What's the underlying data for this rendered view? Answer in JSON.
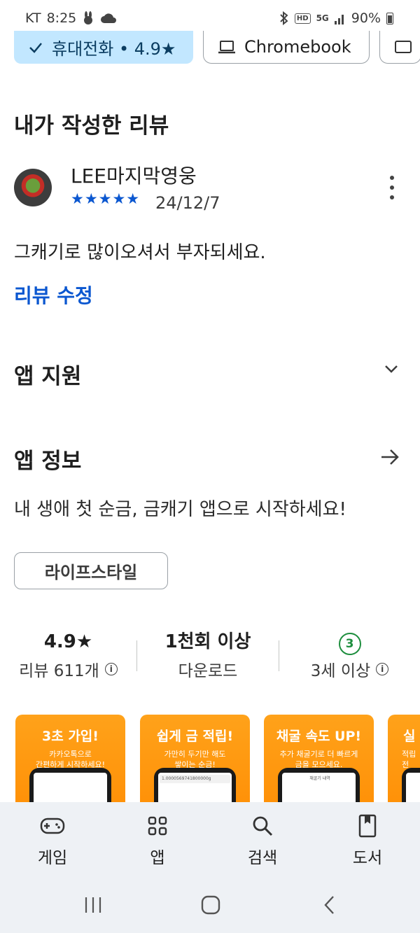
{
  "status_bar": {
    "carrier": "KT",
    "time": "8:25",
    "network": "5G",
    "battery": "90%",
    "icons": [
      "rabbit-icon",
      "cloud-icon",
      "bluetooth-icon",
      "hd-icon",
      "signal-icon",
      "battery-icon"
    ]
  },
  "device_chips": [
    {
      "label": "휴대전화 • 4.9★",
      "icon": "check-icon",
      "selected": true
    },
    {
      "label": "Chromebook",
      "icon": "laptop-icon",
      "selected": false
    },
    {
      "label": "",
      "icon": "tablet-icon",
      "selected": false
    }
  ],
  "my_review": {
    "section_title": "내가 작성한 리뷰",
    "reviewer_name": "LEE마지막영웅",
    "stars": "★★★★★",
    "rating": 5,
    "date": "24/12/7",
    "text": "그캐기로 많이오셔서 부자되세요.",
    "edit_label": "리뷰 수정"
  },
  "app_support": {
    "title": "앱 지원",
    "icon": "chevron-down-icon"
  },
  "app_info": {
    "title": "앱 정보",
    "icon": "arrow-right-icon",
    "description": "내 생애 첫 순금, 금캐기 앱으로 시작하세요!",
    "category": "라이프스타일"
  },
  "stats": {
    "rating_value": "4.9★",
    "rating_label": "리뷰 611개",
    "downloads_value": "1천회 이상",
    "downloads_label": "다운로드",
    "age_badge": "3",
    "age_label": "3세 이상"
  },
  "screenshots": [
    {
      "title": "3초 가입!",
      "subtitle": "카카오톡으로\n간편하게 시작하세요!",
      "screen_text": ""
    },
    {
      "title": "쉽게 금 적립!",
      "subtitle": "가만히 두기만 해도\n쌓이는 순금!",
      "screen_text": "1.0000569741800000g"
    },
    {
      "title": "채굴 속도 UP!",
      "subtitle": "추가 채굴기로 더 빠르게\n금을 모으세요.",
      "screen_text": "채굴기 내역"
    },
    {
      "title": "실",
      "subtitle": "적립\n전",
      "screen_text": ""
    }
  ],
  "bottom_nav": [
    {
      "label": "게임",
      "icon": "gamepad-icon"
    },
    {
      "label": "앱",
      "icon": "apps-grid-icon"
    },
    {
      "label": "검색",
      "icon": "search-icon"
    },
    {
      "label": "도서",
      "icon": "book-icon"
    }
  ],
  "system_nav": [
    "recents-icon",
    "home-icon",
    "back-icon"
  ]
}
